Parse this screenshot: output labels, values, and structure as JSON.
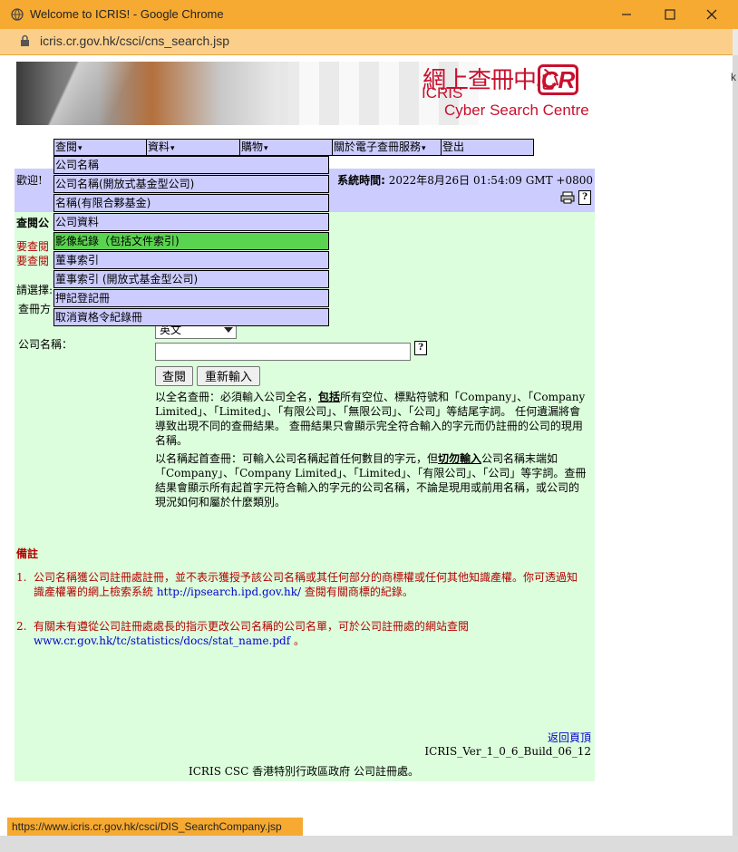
{
  "window": {
    "title": "Welcome to ICRIS! - Google Chrome",
    "url": "icris.cr.gov.hk/csci/cns_search.jsp",
    "side_letter": "k"
  },
  "banner": {
    "cn_title": "網上查冊中心",
    "icris": "ICRIS",
    "subtitle": "Cyber Search Centre",
    "logo": "CR"
  },
  "menu": {
    "items": [
      {
        "label": "查閱",
        "caret": "▾"
      },
      {
        "label": "資料",
        "caret": "▾"
      },
      {
        "label": "購物",
        "caret": "▾"
      },
      {
        "label": "關於電子查冊服務",
        "caret": "▾"
      },
      {
        "label": "登出",
        "caret": ""
      }
    ],
    "dropdown": [
      "公司名稱",
      "公司名稱(開放式基金型公司)",
      "名稱(有限合夥基金)",
      "公司資料",
      "影像紀錄（包括文件索引)",
      "董事索引",
      "董事索引 (開放式基金型公司)",
      "押記登記冊",
      "取消資格令紀錄冊"
    ],
    "active_index": 4
  },
  "header": {
    "welcome": "歡迎!",
    "systime_label": "系統時間:",
    "systime_value": "2022年8月26日 01:54:09 GMT +0800"
  },
  "content": {
    "section_title": "查閱公",
    "red_link_1": "要查閱",
    "red_link_2": "要查閱",
    "choose": "請選擇:",
    "search_by": "查冊方",
    "lang_value": "英文",
    "company_name_label": "公司名稱：",
    "search_button": "查閱",
    "reset_button": "重新輸入",
    "note1_pre": "以全名查冊：必須輸入公司全名，",
    "note1_bold": "包括",
    "note1_post": "所有空位、標點符號和「Company」、「Company Limited」、「Limited」、「有限公司」、「無限公司」、「公司」等結尾字詞。 任何遺漏將會導致出現不同的查冊結果。 查冊結果只會顯示完全符合輸入的字元而仍註冊的公司的現用名稱。",
    "note2_pre": "以名稱起首查冊：可輸入公司名稱起首任何數目的字元，但",
    "note2_bold": "切勿輸入",
    "note2_post": "公司名稱末端如「Company」、「Company Limited」、「Limited」、「有限公司」、「公司」等字詞。查冊結果會顯示所有起首字元符合輸入的字元的公司名稱，不論是現用或前用名稱，或公司的現況如何和屬於什麼類別。"
  },
  "remarks": {
    "title": "備註",
    "r1_num": "1.",
    "r1_pre": "公司名稱獲公司註冊處註冊，並不表示獲授予該公司名稱或其任何部分的商標權或任何其他知識產權。你可透過知識產權署的網上檢索系統 ",
    "r1_link": "http://ipsearch.ipd.gov.hk/",
    "r1_post": " 查閱有關商標的紀錄。",
    "r2_num": "2.",
    "r2_pre": "有關未有遵從公司註冊處處長的指示更改公司名稱的公司名單，可於公司註冊處的網站查閱",
    "r2_link": "www.cr.gov.hk/tc/statistics/docs/stat_name.pdf",
    "r2_post": " 。"
  },
  "footer": {
    "back_home": "返回頁頂",
    "version": "ICRIS_Ver_1_0_6_Build_06_12",
    "copyright": "ICRIS CSC 香港特別行政區政府 公司註冊處。"
  },
  "status_bar": {
    "url": "https://www.icris.cr.gov.hk/csci/DIS_SearchCompany.jsp"
  },
  "colors": {
    "titlebar": "#f6aa32",
    "menu_bg": "#ccccff",
    "active_item": "#5ad350",
    "panel_bg": "#dcfedc",
    "remark_red": "#b40000"
  }
}
